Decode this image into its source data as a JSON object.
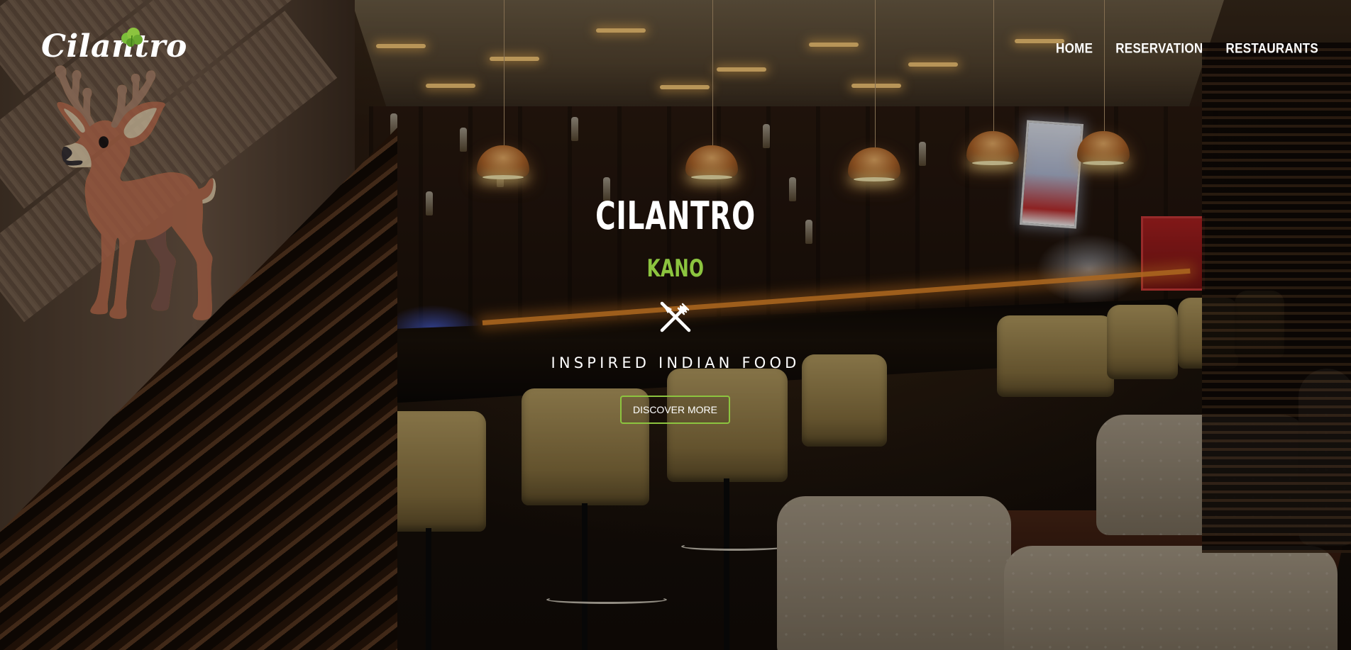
{
  "brand": {
    "logo_text": "Cilantro",
    "accent_color": "#8cc43f"
  },
  "nav": {
    "items": [
      {
        "label": "HOME"
      },
      {
        "label": "RESERVATION"
      },
      {
        "label": "RESTAURANTS"
      }
    ]
  },
  "hero": {
    "title": "CILANTRO",
    "location": "KANO",
    "icon": "cutlery-icon",
    "tagline": "INSPIRED INDIAN FOOD",
    "cta_label": "DISCOVER MORE",
    "background": "restaurant bar interior photo"
  }
}
